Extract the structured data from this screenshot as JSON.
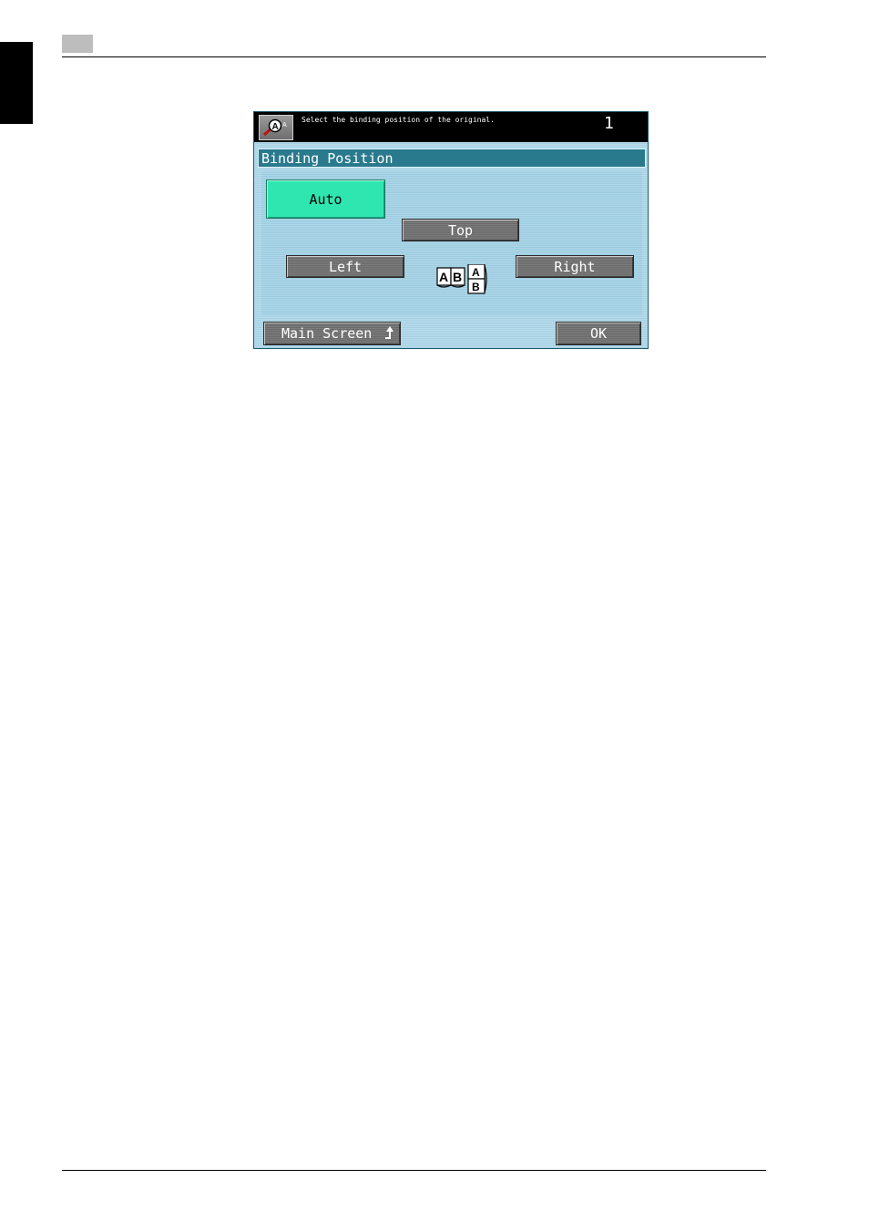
{
  "panel": {
    "message": "Select the binding position of the original.",
    "copy_count": "1",
    "title": "Binding Position",
    "buttons": {
      "auto": "Auto",
      "top": "Top",
      "left": "Left",
      "right": "Right"
    },
    "selected": "auto",
    "book_icon_letters": [
      "A",
      "B",
      "A",
      "B"
    ],
    "footer": {
      "main_screen": "Main Screen",
      "ok": "OK"
    },
    "colors": {
      "selected": "#2fe6b0",
      "title_bar": "#2a7a8e",
      "screen": "#b7dcec"
    }
  }
}
